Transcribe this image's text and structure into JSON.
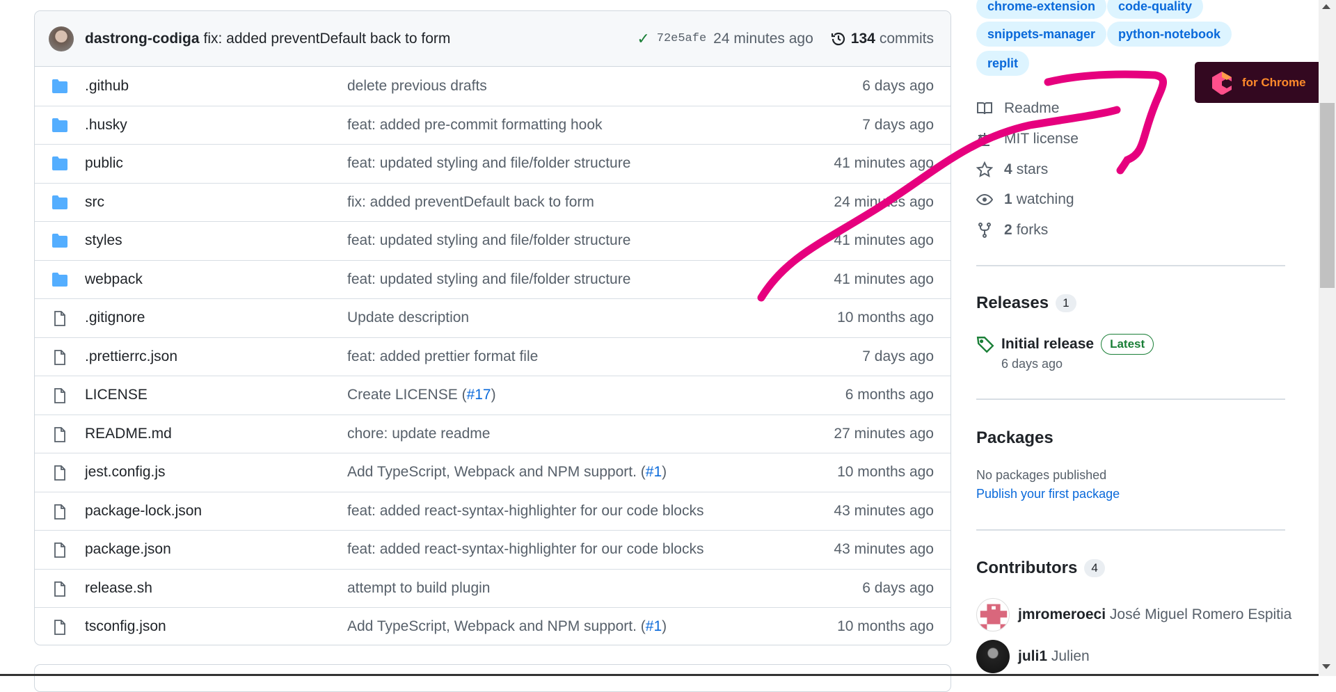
{
  "latest_commit": {
    "author": "dastrong-codiga",
    "message": "fix: added preventDefault back to form",
    "sha": "72e5afe",
    "time": "24 minutes ago",
    "commit_count": "134",
    "commits_label": "commits"
  },
  "files": [
    {
      "type": "folder",
      "name": ".github",
      "message": "delete previous drafts",
      "date": "6 days ago"
    },
    {
      "type": "folder",
      "name": ".husky",
      "message": "feat: added pre-commit formatting hook",
      "date": "7 days ago"
    },
    {
      "type": "folder",
      "name": "public",
      "message": "feat: updated styling and file/folder structure",
      "date": "41 minutes ago"
    },
    {
      "type": "folder",
      "name": "src",
      "message": "fix: added preventDefault back to form",
      "date": "24 minutes ago"
    },
    {
      "type": "folder",
      "name": "styles",
      "message": "feat: updated styling and file/folder structure",
      "date": "41 minutes ago"
    },
    {
      "type": "folder",
      "name": "webpack",
      "message": "feat: updated styling and file/folder structure",
      "date": "41 minutes ago"
    },
    {
      "type": "file",
      "name": ".gitignore",
      "message": "Update description",
      "date": "10 months ago"
    },
    {
      "type": "file",
      "name": ".prettierrc.json",
      "message": "feat: added prettier format file",
      "date": "7 days ago"
    },
    {
      "type": "file",
      "name": "LICENSE",
      "message": "Create LICENSE (",
      "link": "#17",
      "suffix": ")",
      "date": "6 months ago"
    },
    {
      "type": "file",
      "name": "README.md",
      "message": "chore: update readme",
      "date": "27 minutes ago"
    },
    {
      "type": "file",
      "name": "jest.config.js",
      "message": "Add TypeScript, Webpack and NPM support. (",
      "link": "#1",
      "suffix": ")",
      "date": "10 months ago"
    },
    {
      "type": "file",
      "name": "package-lock.json",
      "message": "feat: added react-syntax-highlighter for our code blocks",
      "date": "43 minutes ago"
    },
    {
      "type": "file",
      "name": "package.json",
      "message": "feat: added react-syntax-highlighter for our code blocks",
      "date": "43 minutes ago"
    },
    {
      "type": "file",
      "name": "release.sh",
      "message": "attempt to build plugin",
      "date": "6 days ago"
    },
    {
      "type": "file",
      "name": "tsconfig.json",
      "message": "Add TypeScript, Webpack and NPM support. (",
      "link": "#1",
      "suffix": ")",
      "date": "10 months ago"
    }
  ],
  "topics": [
    "chrome-extension",
    "code-quality",
    "snippets-manager",
    "python-notebook",
    "replit"
  ],
  "about": {
    "readme": "Readme",
    "license": "MIT license",
    "stars_count": "4",
    "stars_label": "stars",
    "watching_count": "1",
    "watching_label": "watching",
    "forks_count": "2",
    "forks_label": "forks"
  },
  "releases": {
    "title": "Releases",
    "count": "1",
    "name": "Initial release",
    "badge": "Latest",
    "date": "6 days ago"
  },
  "packages": {
    "title": "Packages",
    "empty": "No packages published",
    "link": "Publish your first package"
  },
  "contributors": {
    "title": "Contributors",
    "count": "4",
    "list": [
      {
        "login": "jmromeroeci",
        "name": "José Miguel Romero Espitia"
      },
      {
        "login": "juli1",
        "name": "Julien"
      }
    ]
  },
  "extension_badge": {
    "label": "for Chrome"
  },
  "colors": {
    "accent": "#0969da",
    "success": "#1a7f37",
    "annotation": "#e6007e",
    "badge_bg": "#330820"
  }
}
